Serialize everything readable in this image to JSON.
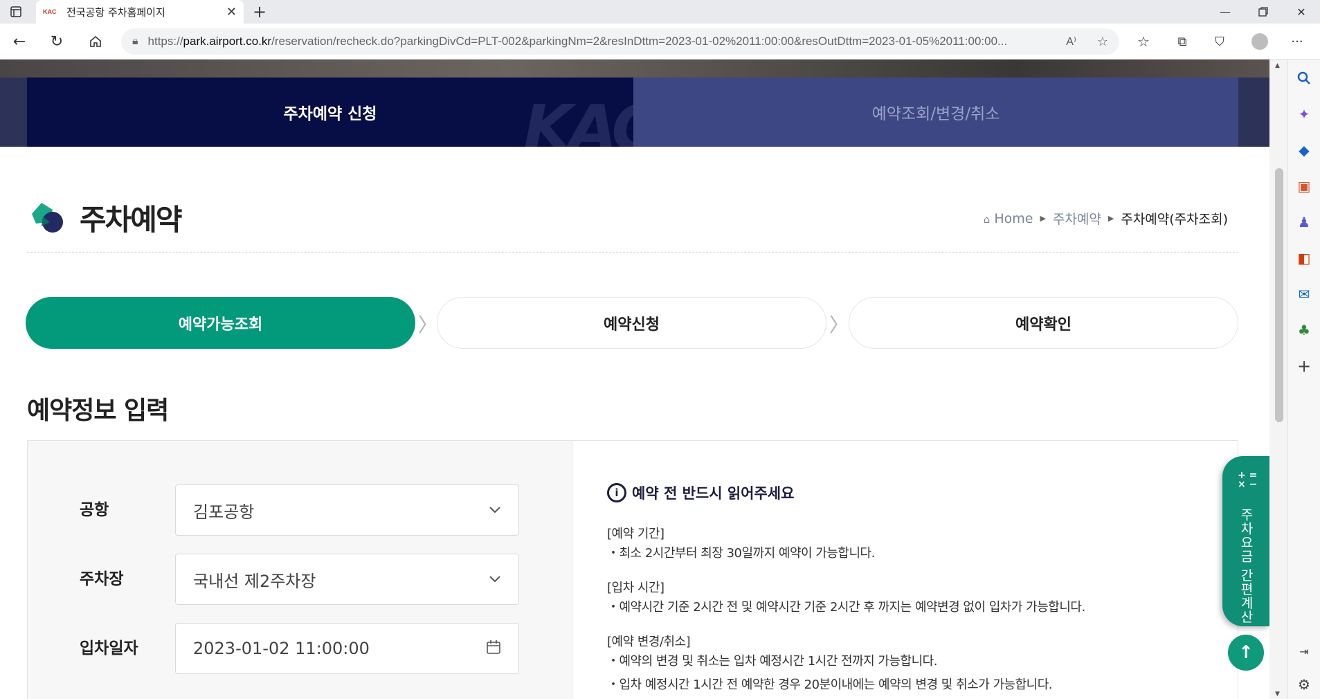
{
  "browser": {
    "tab_title": "전국공항 주차홈페이지",
    "tab_favicon": "KAC",
    "url_prefix": "https://",
    "url_host": "park.airport.co.kr",
    "url_path": "/reservation/recheck.do?parkingDivCd=PLT-002&parkingNm=2&resInDttm=2023-01-02%2011:00:00&resOutDttm=2023-01-05%2011:00:00..."
  },
  "topnav": {
    "item1": "주차예약 신청",
    "item2": "예약조회/변경/취소",
    "watermark": "KAC"
  },
  "page": {
    "title": "주차예약",
    "breadcrumb": {
      "home": "Home",
      "level1": "주차예약",
      "current": "주차예약(주차조회)"
    }
  },
  "steps": [
    "예약가능조회",
    "예약신청",
    "예약확인"
  ],
  "form": {
    "section_title": "예약정보 입력",
    "airport_label": "공항",
    "airport_value": "김포공항",
    "lot_label": "주차장",
    "lot_value": "국내선 제2주차장",
    "entry_label": "입차일자",
    "entry_value": "2023-01-02 11:00:00"
  },
  "info": {
    "heading": "예약 전 반드시 읽어주세요",
    "lines": [
      "[예약 기간]",
      "・최소 2시간부터 최장 30일까지 예약이 가능합니다.",
      "[입차 시간]",
      "・예약시간 기준 2시간 전 및 예약시간 기준 2시간 후 까지는 예약변경 없이 입차가 가능합니다.",
      "[예약 변경/취소]",
      "・예약의 변경 및 취소는 입차 예정시간 1시간 전까지 가능합니다.",
      "・입차 예정시간 1시간 전 예약한 경우 20분이내에는 예약의 변경 및 취소가 가능합니다."
    ]
  },
  "floating": {
    "calc_label": "주차요금 간편계산",
    "calc_icon": "+ =\n× −"
  },
  "colors": {
    "primary_green": "#039a7c",
    "nav_dark": "#070d45",
    "nav_mid": "#3d4784"
  }
}
